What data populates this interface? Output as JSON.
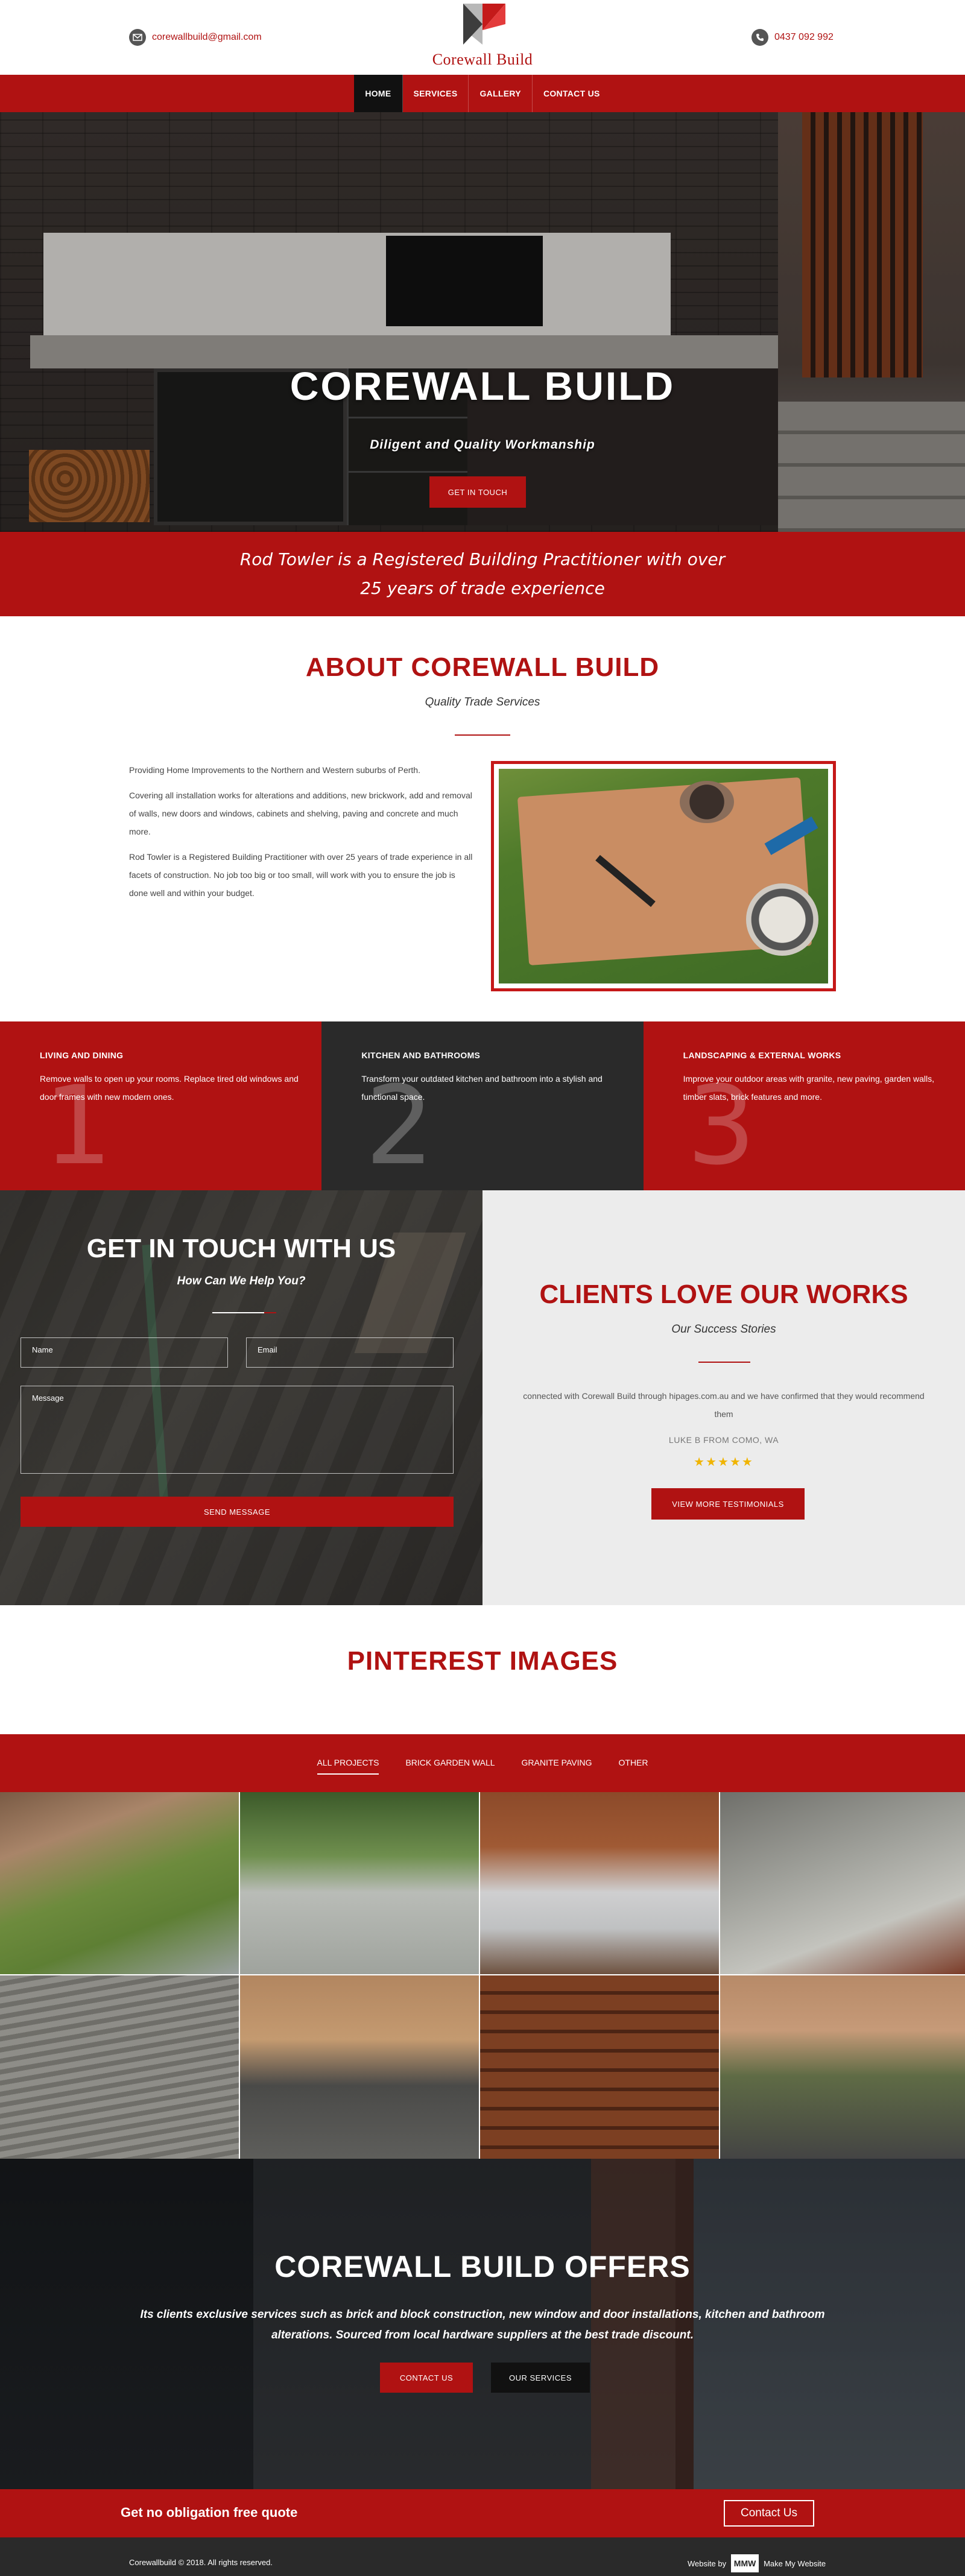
{
  "header": {
    "email": "corewallbuild@gmail.com",
    "phone": "0437 092 992",
    "logo_text": "Corewall Build"
  },
  "nav": {
    "items": [
      {
        "label": "HOME",
        "active": true
      },
      {
        "label": "SERVICES",
        "active": false
      },
      {
        "label": "GALLERY",
        "active": false
      },
      {
        "label": "CONTACT US",
        "active": false
      }
    ]
  },
  "hero": {
    "title": "COREWALL BUILD",
    "subtitle": "Diligent and Quality Workmanship",
    "button": "GET IN TOUCH"
  },
  "intro": {
    "line1": "Rod Towler is a Registered Building Practitioner with over",
    "line2": "25 years of trade experience"
  },
  "about": {
    "title": "ABOUT COREWALL BUILD",
    "subtitle": "Quality Trade Services",
    "p1": "Providing Home Improvements to the Northern and Western suburbs of Perth.",
    "p2": "Covering all installation works for alterations and additions, new brickwork, add and removal of walls, new doors and windows, cabinets and shelving, paving and concrete and much more.",
    "p3": "Rod Towler is a Registered Building Practitioner with over 25 years of trade experience in all facets of construction. No job too big or too small, will work with you to ensure the job is done well and within your budget."
  },
  "services": [
    {
      "num": "1",
      "title": "LIVING AND DINING",
      "text": "Remove walls to open up your rooms. Replace tired old windows and door frames with new modern ones."
    },
    {
      "num": "2",
      "title": "KITCHEN AND BATHROOMS",
      "text": "Transform your outdated kitchen and bathroom into a stylish and functional space."
    },
    {
      "num": "3",
      "title": "LANDSCAPING & EXTERNAL WORKS",
      "text": "Improve your outdoor areas with granite, new paving, garden walls, timber slats, brick features and more."
    }
  ],
  "contact": {
    "title": "GET IN TOUCH WITH US",
    "subtitle": "How Can We Help You?",
    "name_placeholder": "Name",
    "email_placeholder": "Email",
    "message_placeholder": "Message",
    "send": "SEND MESSAGE"
  },
  "testimonials": {
    "title": "CLIENTS LOVE OUR WORKS",
    "subtitle": "Our Success Stories",
    "quote": "connected with Corewall Build through hipages.com.au and we have confirmed that they would recommend them",
    "author": "LUKE B FROM COMO, WA",
    "rating": 5,
    "stars": "★★★★★",
    "button": "VIEW MORE TESTIMONIALS"
  },
  "pinterest": {
    "title": "PINTEREST IMAGES",
    "filters": [
      {
        "label": "ALL PROJECTS",
        "active": true
      },
      {
        "label": "BRICK GARDEN WALL",
        "active": false
      },
      {
        "label": "GRANITE PAVING",
        "active": false
      },
      {
        "label": "OTHER",
        "active": false
      }
    ]
  },
  "offers": {
    "title": "COREWALL BUILD OFFERS",
    "desc": "Its clients exclusive services such as brick and block construction, new window and door installations, kitchen and bathroom alterations. Sourced from local hardware suppliers at the best trade discount.",
    "contact_btn": "CONTACT US",
    "services_btn": "OUR SERVICES"
  },
  "quote_bar": {
    "text": "Get no obligation free quote",
    "button": "Contact Us"
  },
  "footer": {
    "copyright": "Corewallbuild © 2018. All rights reserved.",
    "credit_prefix": "Website by",
    "credit_logo": "MMW",
    "credit_name": "Make My Website"
  },
  "colors": {
    "brand_red": "#b01212",
    "dark": "#2a2a2a",
    "star": "#f0b400"
  }
}
